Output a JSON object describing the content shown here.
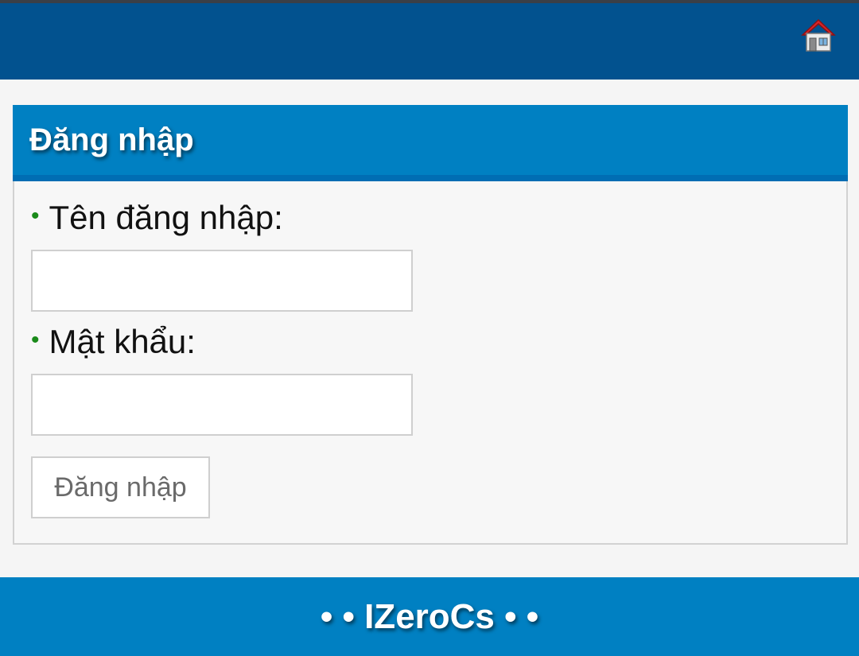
{
  "header": {
    "home_icon": "home-icon"
  },
  "login": {
    "title": "Đăng nhập",
    "username_label": "Tên đăng nhập:",
    "username_value": "",
    "password_label": "Mật khẩu:",
    "password_value": "",
    "submit_label": "Đăng nhập",
    "bullet": "•"
  },
  "footer": {
    "text": "• • IZeroCs • •"
  },
  "colors": {
    "header_bg": "#02528f",
    "panel_title_bg": "#0080c2",
    "footer_bg": "#0080c2",
    "bullet": "#1a8a1a"
  }
}
